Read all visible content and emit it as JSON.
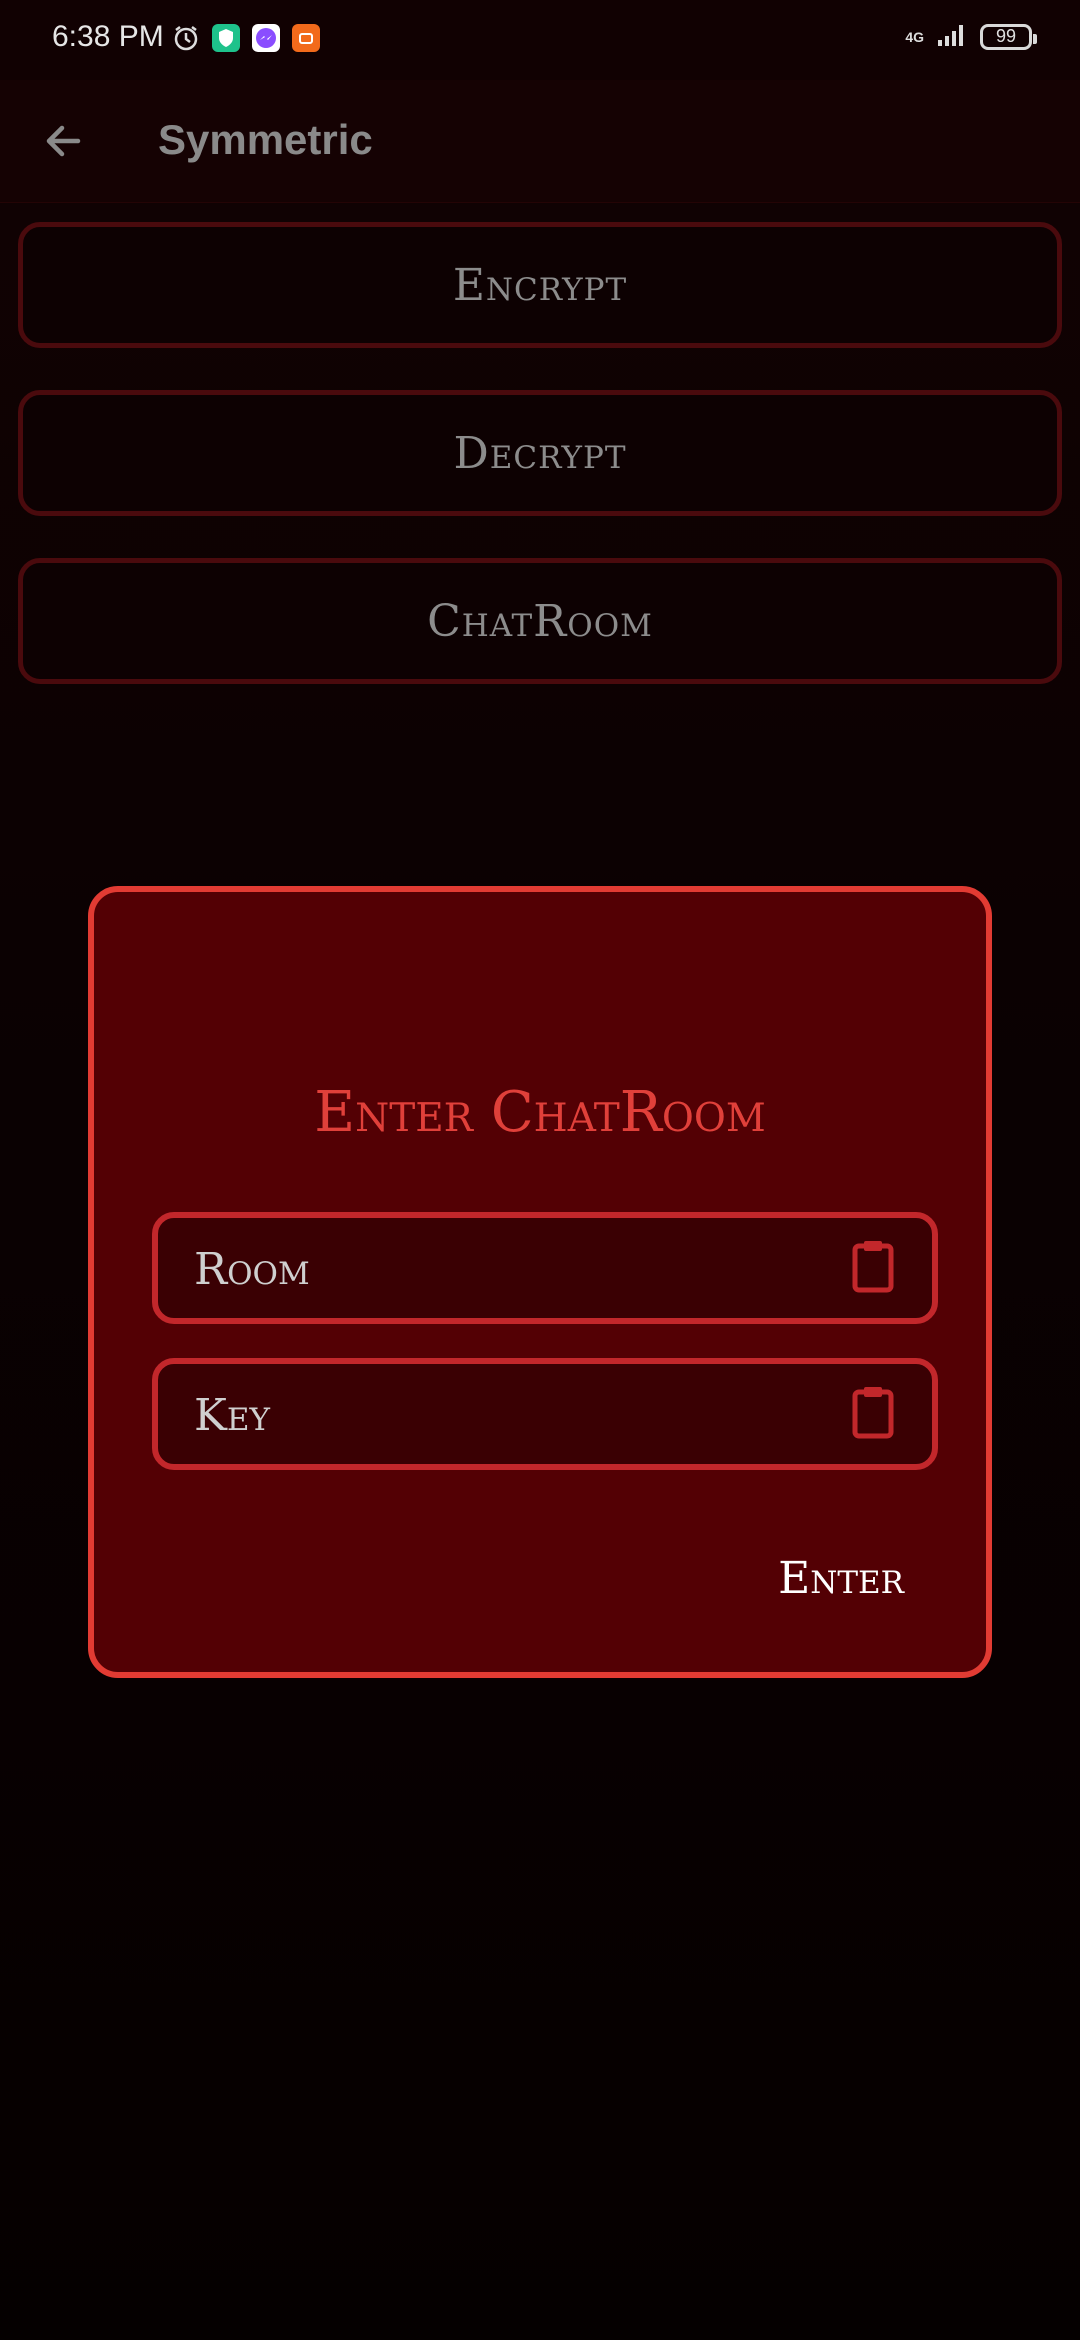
{
  "status": {
    "time": "6:38 PM",
    "network": "4G",
    "battery": "99"
  },
  "appbar": {
    "title": "Symmetric"
  },
  "menu": {
    "items": [
      {
        "label": "Encrypt"
      },
      {
        "label": "Decrypt"
      },
      {
        "label": "ChatRoom"
      }
    ]
  },
  "dialog": {
    "title": "Enter ChatRoom",
    "room_placeholder": "Room",
    "key_placeholder": "Key",
    "enter_label": "Enter"
  },
  "colors": {
    "accent": "#e23b33",
    "dialog_bg": "#530004",
    "field_bg": "#3a0003",
    "field_border": "#c2272b",
    "button_border": "#4a0a0d"
  },
  "icons": [
    "alarm-icon",
    "shield-app-icon",
    "messenger-icon",
    "orange-app-icon",
    "signal-icon",
    "battery-icon",
    "back-arrow-icon",
    "clipboard-icon"
  ]
}
